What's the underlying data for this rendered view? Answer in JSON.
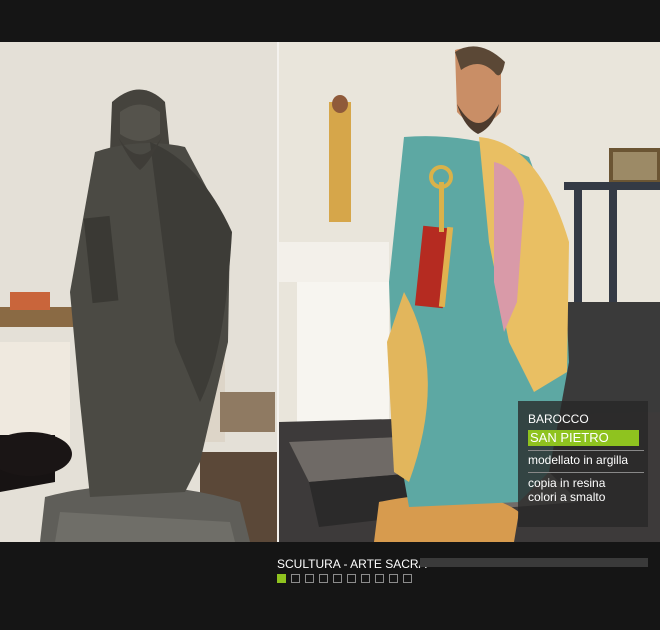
{
  "info": {
    "style": "BAROCCO",
    "title": "SAN PIETRO",
    "line1": "modellato in argilla",
    "line2": "copia in resina",
    "line3": "colori a smalto"
  },
  "footer": {
    "category": "SCULTURA - ARTE SACRA",
    "progress_percent": 0,
    "page_count": 10,
    "active_page": 1
  },
  "colors": {
    "accent": "#8fc31f",
    "background": "#151515"
  }
}
